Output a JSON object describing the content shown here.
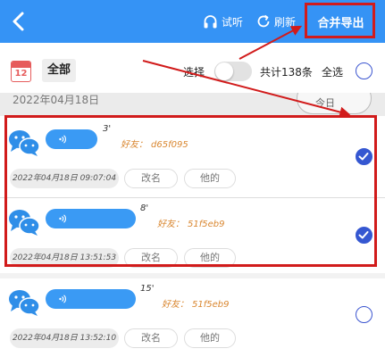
{
  "header": {
    "listen_label": "试听",
    "refresh_label": "刷新",
    "export_label": "合并导出",
    "bg_color": "#3593f5"
  },
  "filters": {
    "calendar_day": "12",
    "category": "全部",
    "selection_label": "选择",
    "total_label": "共计138条",
    "select_all_label": "全选"
  },
  "date_group": {
    "date": "2022年04月18日",
    "side_label": "今日"
  },
  "records": [
    {
      "duration": "3'",
      "friend_label": "好友：",
      "friend_id": "d65f095",
      "time": "2022年04月18日 09:07:04",
      "rename_label": "改名",
      "other_label": "他的",
      "selected": true
    },
    {
      "duration": "8'",
      "friend_label": "好友：",
      "friend_id": "51f5eb9",
      "time": "2022年04月18日 13:51:53",
      "rename_label": "改名",
      "other_label": "他的",
      "selected": true
    },
    {
      "duration": "15'",
      "friend_label": "好友：",
      "friend_id": "51f5eb9",
      "time": "2022年04月18日 13:52:10",
      "rename_label": "改名",
      "other_label": "他的",
      "selected": false
    }
  ],
  "colors": {
    "accent": "#3593f5",
    "friend_text": "#d9862f",
    "checked_radio": "#3557d1",
    "annotation_red": "#d11b1b"
  }
}
